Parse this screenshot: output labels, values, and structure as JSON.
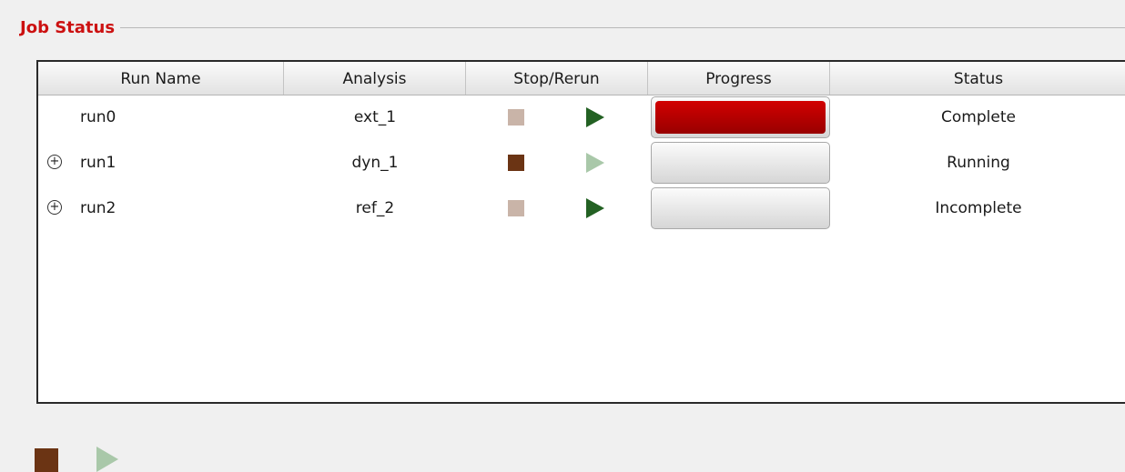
{
  "group": {
    "title": "Job Status"
  },
  "table": {
    "columns": [
      "Run Name",
      "Analysis",
      "Stop/Rerun",
      "Progress",
      "Status"
    ],
    "rows": [
      {
        "name": "run0",
        "expander": "",
        "analysis": "ext_1",
        "status": "Complete",
        "stop_enabled": false,
        "rerun_enabled": true,
        "progress": 1.0
      },
      {
        "name": "run1",
        "expander": "+",
        "analysis": "dyn_1",
        "status": "Running",
        "stop_enabled": true,
        "rerun_enabled": false,
        "progress": 0.0
      },
      {
        "name": "run2",
        "expander": "+",
        "analysis": "ref_2",
        "status": "Incomplete",
        "stop_enabled": false,
        "rerun_enabled": true,
        "progress": 0.0
      }
    ]
  },
  "toolbar": {
    "stop_all_enabled": true,
    "run_all_enabled": false
  },
  "colors": {
    "title": "#cc1111",
    "stop_active": "#6b3414",
    "stop_dim": "#c9b4a8",
    "play_active": "#236123",
    "play_dim": "#a9c8a9",
    "progress_fill": "#c00000"
  },
  "icons": {
    "stop": "stop-square-icon",
    "play": "play-triangle-icon",
    "expand": "expand-plus-circle-icon"
  }
}
